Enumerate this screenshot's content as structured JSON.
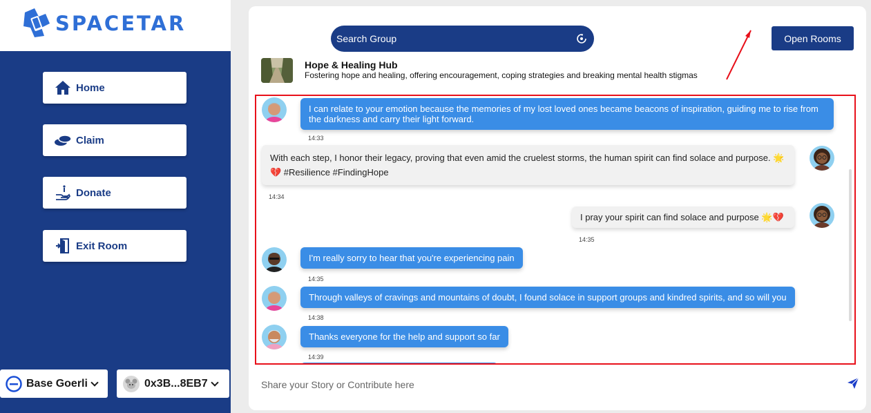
{
  "brand": {
    "name": "SPACETAR"
  },
  "nav": [
    {
      "label": "Home",
      "icon": "home-icon"
    },
    {
      "label": "Claim",
      "icon": "coins-icon"
    },
    {
      "label": "Donate",
      "icon": "donate-hand-icon"
    },
    {
      "label": "Exit Room",
      "icon": "exit-door-icon"
    }
  ],
  "network": {
    "label": "Base Goerli"
  },
  "wallet": {
    "label": "0x3B...8EB7"
  },
  "search": {
    "placeholder": "Search Group"
  },
  "open_rooms": {
    "label": "Open Rooms"
  },
  "group": {
    "title": "Hope & Healing Hub",
    "description": "Fostering hope and healing, offering encouragement, coping strategies and breaking mental health stigmas"
  },
  "messages": [
    {
      "side": "in",
      "text": "I can relate to your emotion because the memories of my lost loved ones became beacons of inspiration, guiding me to rise from the darkness and carry their light forward.",
      "time": "14:33"
    },
    {
      "side": "out",
      "text": "With each step, I honor their legacy, proving that even amid the cruelest storms, the human spirit can find solace and purpose. 🌟💔 #Resilience #FindingHope",
      "time": "14:34"
    },
    {
      "side": "out",
      "text": "I pray your spirit can find solace and purpose 🌟💔",
      "time": "14:35"
    },
    {
      "side": "in",
      "text": "I'm really sorry to hear that you're experiencing pain",
      "time": "14:35"
    },
    {
      "side": "in",
      "text": "Through valleys of cravings and mountains of doubt, I found solace in support groups and kindred spirits, and so will you",
      "time": "14:38"
    },
    {
      "side": "in",
      "text": "Thanks everyone for the help and support so far",
      "time": "14:39"
    }
  ],
  "compose": {
    "placeholder": "Share your Story or Contribute here"
  },
  "colors": {
    "sidebar": "#1a3c86",
    "accent": "#3a8de6",
    "highlight": "#e8101a"
  }
}
